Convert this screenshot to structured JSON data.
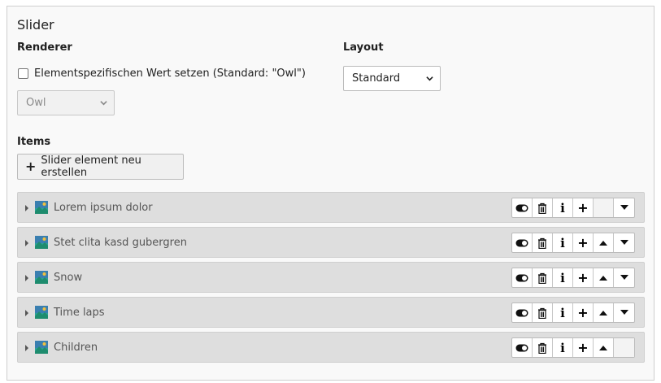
{
  "section": {
    "title": "Slider"
  },
  "renderer": {
    "label": "Renderer",
    "checkbox_label": "Elementspezifischen Wert setzen (Standard: \"Owl\")",
    "select_value": "Owl"
  },
  "layout": {
    "label": "Layout",
    "select_value": "Standard"
  },
  "items": {
    "label": "Items",
    "new_button_label": "Slider element neu erstellen",
    "rows": [
      {
        "title": "Lorem ipsum dolor",
        "can_move_up": false,
        "can_move_down": true
      },
      {
        "title": "Stet clita kasd gubergren",
        "can_move_up": true,
        "can_move_down": true
      },
      {
        "title": "Snow",
        "can_move_up": true,
        "can_move_down": true
      },
      {
        "title": "Time laps",
        "can_move_up": true,
        "can_move_down": true
      },
      {
        "title": "Children",
        "can_move_up": true,
        "can_move_down": false
      }
    ]
  },
  "icons": {
    "row_actions": [
      "toggle-icon",
      "trash-icon",
      "info-icon",
      "plus-icon",
      "arrow-up-icon",
      "arrow-down-icon"
    ],
    "row_icon": "image-icon"
  },
  "colors": {
    "panel_bg": "#f9f9f9",
    "row_bg": "#dedede",
    "icon_teal": "#2aa198"
  }
}
